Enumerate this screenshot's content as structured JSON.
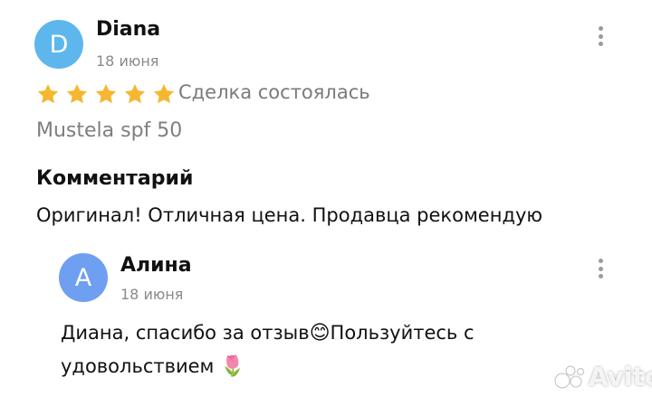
{
  "review": {
    "author": {
      "initial": "D",
      "name": "Diana",
      "date": "18 июня"
    },
    "rating": {
      "stars": 5,
      "max": 5,
      "color": "#f5b731"
    },
    "deal_status": "Сделка состоялась",
    "product": "Mustela spf 50",
    "comment_heading": "Комментарий",
    "comment_text": "Оригинал! Отличная цена. Продавца рекомендую"
  },
  "reply": {
    "author": {
      "initial": "А",
      "name": "Алина",
      "date": "18 июня"
    },
    "text_part1": "Диана, спасибо за отзыв",
    "emoji_smile": "😊",
    "text_part2": "Пользуйтесь с удовольствием ",
    "emoji_tulip": "🌷"
  },
  "watermark": {
    "text": "Avito",
    "icon": "avito-logo-icon"
  }
}
